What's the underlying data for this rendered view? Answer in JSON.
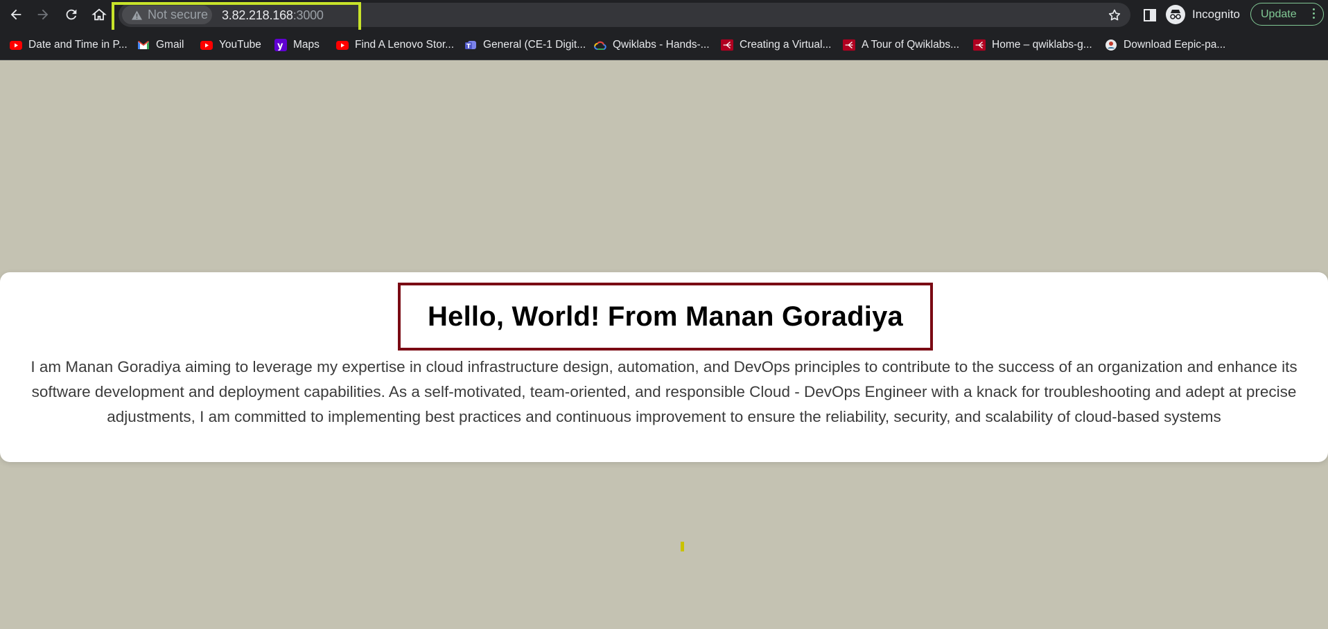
{
  "browser": {
    "security_label": "Not secure",
    "url_host": "3.82.218.168",
    "url_port": ":3000",
    "profile_label": "Incognito",
    "update_label": "Update",
    "highlight_color": "#c8e32a"
  },
  "bookmarks": [
    {
      "label": "Date and Time in P...",
      "icon": "youtube-icon"
    },
    {
      "label": "Gmail",
      "icon": "gmail-icon"
    },
    {
      "label": "YouTube",
      "icon": "youtube-icon"
    },
    {
      "label": "Maps",
      "icon": "yahoo-icon"
    },
    {
      "label": "Find A Lenovo Stor...",
      "icon": "youtube-icon"
    },
    {
      "label": "General (CE-1 Digit...",
      "icon": "teams-icon"
    },
    {
      "label": "Qwiklabs - Hands-...",
      "icon": "google-cloud-icon"
    },
    {
      "label": "Creating a Virtual...",
      "icon": "qwiklabs-icon"
    },
    {
      "label": "A Tour of Qwiklabs...",
      "icon": "qwiklabs-icon"
    },
    {
      "label": "Home – qwiklabs-g...",
      "icon": "qwiklabs-icon"
    },
    {
      "label": "Download Eepic-pa...",
      "icon": "globe-icon"
    }
  ],
  "page": {
    "heading": "Hello, World! From Manan Goradiya",
    "bio": "I am Manan Goradiya aiming to leverage my expertise in cloud infrastructure design, automation, and DevOps principles to contribute to the success of an organization and enhance its software development and deployment capabilities. As a self-motivated, team-oriented, and responsible Cloud - DevOps Engineer with a knack for troubleshooting and adept at precise adjustments, I am committed to implementing best practices and continuous improvement to ensure the reliability, security, and scalability of cloud-based systems",
    "background_color": "#c4c2b2",
    "heading_border_color": "#7a0a14"
  }
}
